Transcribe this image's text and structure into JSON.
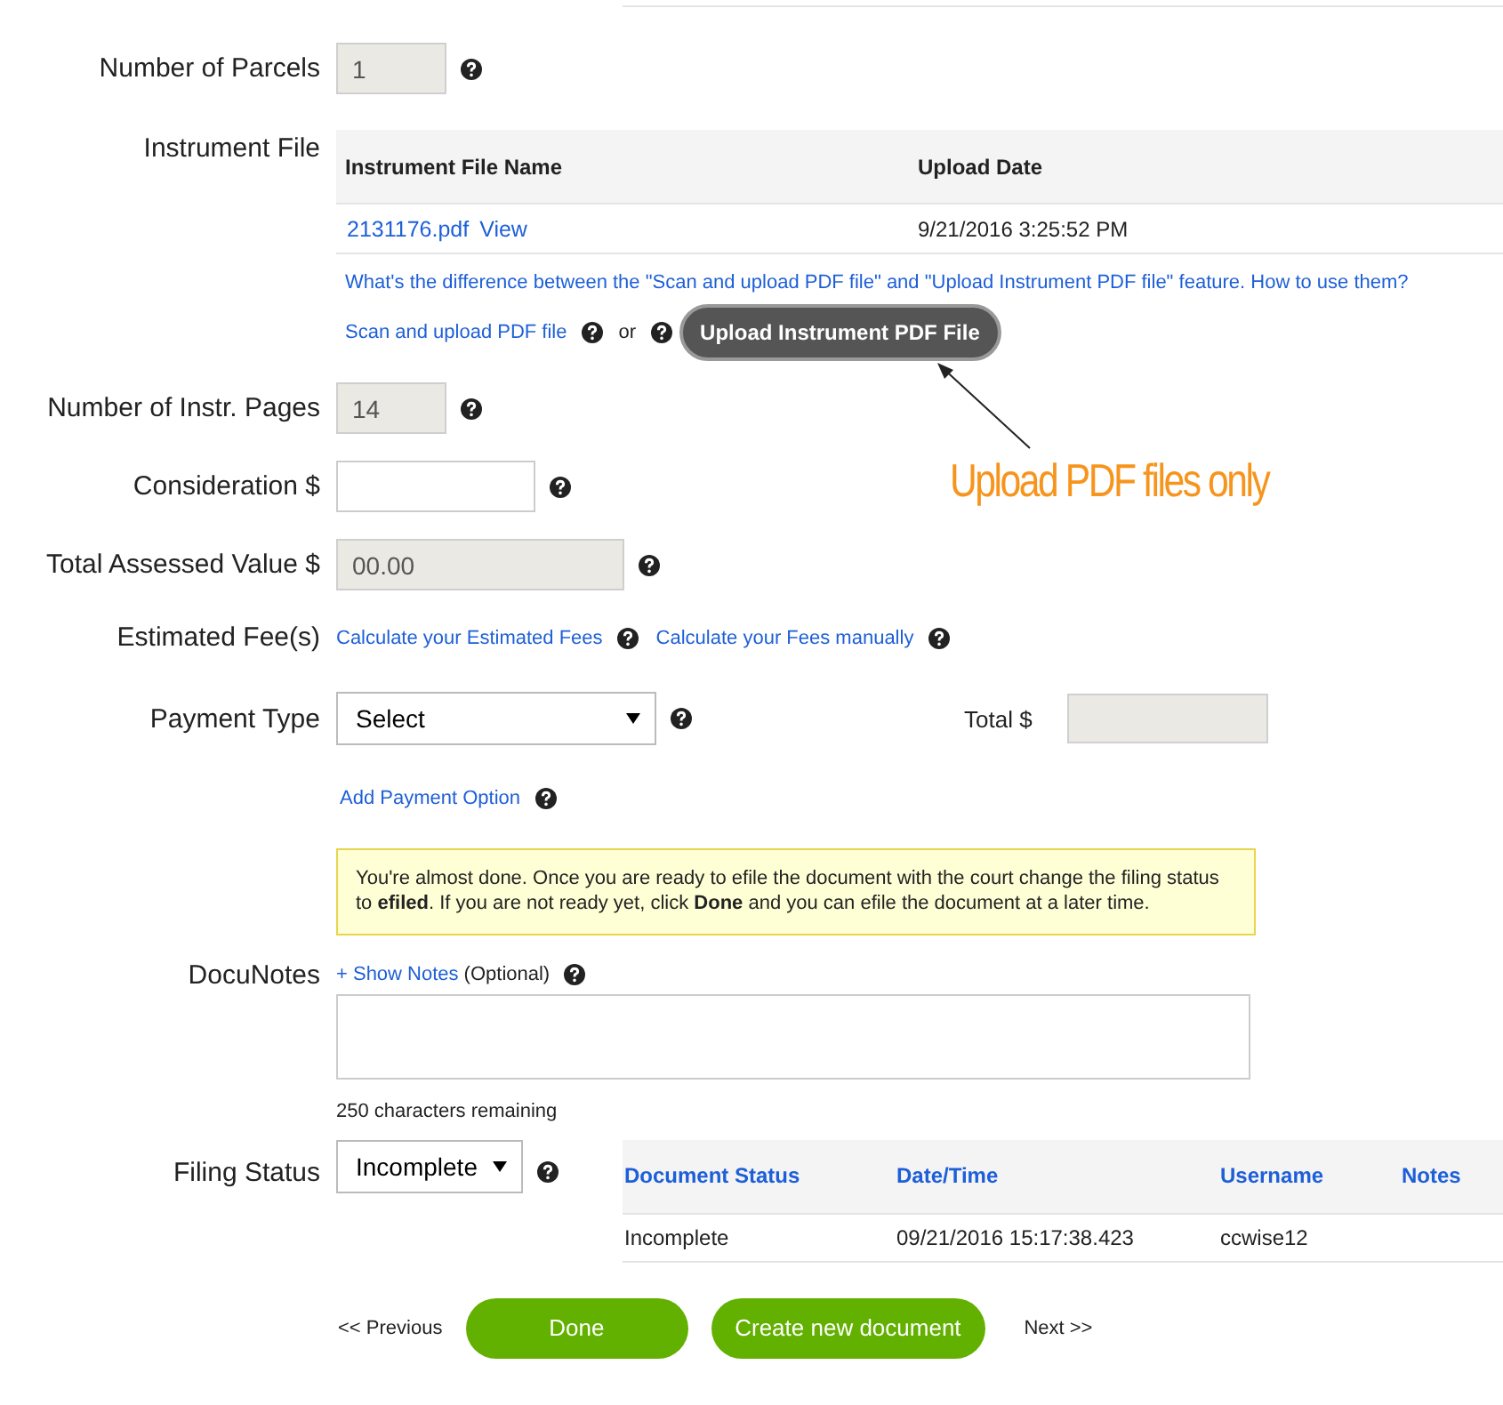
{
  "parcels": {
    "label": "Number of Parcels",
    "value": "1",
    "disabled": true
  },
  "instrument_file": {
    "label": "Instrument File",
    "columns": [
      "Instrument File Name",
      "Upload Date"
    ],
    "rows": [
      {
        "file": "2131176.pdf",
        "link": "View",
        "date": "9/21/2016 3:25:52 PM"
      }
    ],
    "help_link": "What's the difference between the \"Scan and upload PDF file\" and \"Upload Instrument PDF file\" feature. How to use them?",
    "scan_link": "Scan and upload PDF file",
    "or": "or",
    "upload_button": "Upload Instrument PDF File"
  },
  "annotation": "Upload PDF files only",
  "pages": {
    "label": "Number of Instr. Pages",
    "value": "14",
    "disabled": true
  },
  "consideration": {
    "label": "Consideration $",
    "disabled": false
  },
  "assessed": {
    "label": "Total Assessed Value $",
    "value": "00.00",
    "disabled": true
  },
  "fees": {
    "label": "Estimated Fee(s)",
    "links": [
      "Calculate your Estimated Fees",
      "Calculate your Fees manually"
    ]
  },
  "payment": {
    "label": "Payment Type",
    "value": "Select",
    "total_label": "Total $",
    "add_link": "Add Payment Option"
  },
  "notice": "You're almost done. Once you are ready to efile the document with the court change the filing status to **efiled**. If you are not ready yet, click **Done** and you can efile the document at a later time.",
  "docunotes": {
    "label": "DocuNotes",
    "show_link": "+ Show Notes",
    "optional": "(Optional)",
    "remaining": "250 characters remaining"
  },
  "filing": {
    "label": "Filing Status",
    "value": "Incomplete",
    "columns": [
      "Document Status",
      "Date/Time",
      "Username",
      "Notes"
    ],
    "rows": [
      [
        "Incomplete",
        "09/21/2016 15:17:38.423",
        "ccwise12"
      ]
    ]
  },
  "nav": {
    "previous": "<< Previous",
    "done": "Done",
    "create": "Create new document",
    "next": "Next >>"
  }
}
